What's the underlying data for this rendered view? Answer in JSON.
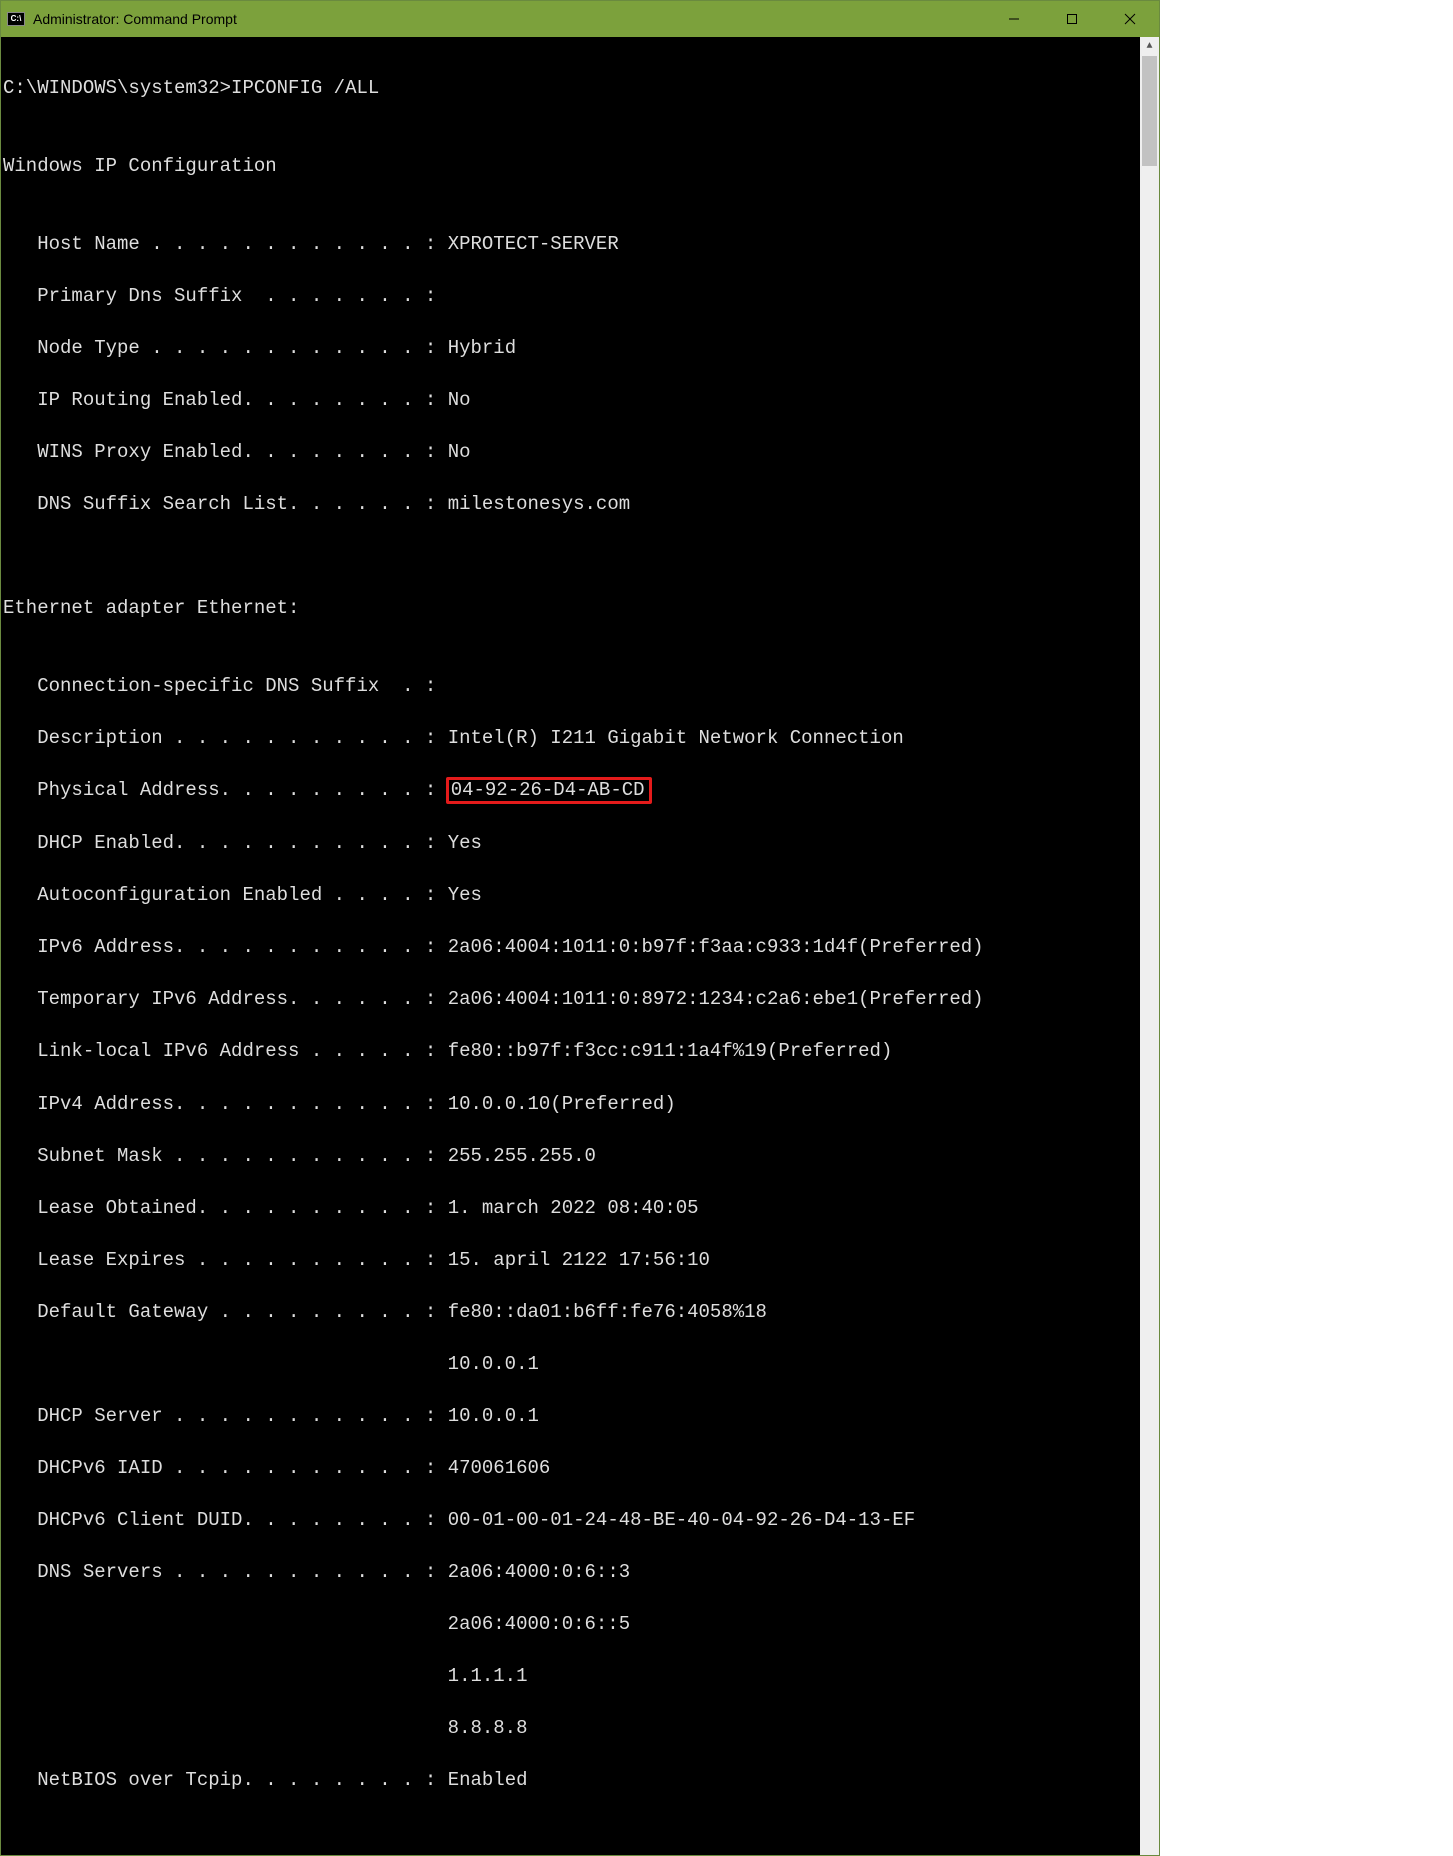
{
  "window": {
    "title": "Administrator: Command Prompt",
    "icon_label": "C:\\"
  },
  "prompt": "C:\\WINDOWS\\system32>",
  "command": "IPCONFIG /ALL",
  "section1_title": "Windows IP Configuration",
  "win_cfg": {
    "host_name_label": "   Host Name . . . . . . . . . . . . : ",
    "host_name": "XPROTECT-SERVER",
    "primary_dns_label": "   Primary Dns Suffix  . . . . . . . :",
    "primary_dns": "",
    "node_type_label": "   Node Type . . . . . . . . . . . . : ",
    "node_type": "Hybrid",
    "ip_routing_label": "   IP Routing Enabled. . . . . . . . : ",
    "ip_routing": "No",
    "wins_proxy_label": "   WINS Proxy Enabled. . . . . . . . : ",
    "wins_proxy": "No",
    "dns_suffix_list_label": "   DNS Suffix Search List. . . . . . : ",
    "dns_suffix_list": "milestonesys.com"
  },
  "section2_title": "Ethernet adapter Ethernet:",
  "eth": {
    "conn_dns_label": "   Connection-specific DNS Suffix  . :",
    "conn_dns": "",
    "description_label": "   Description . . . . . . . . . . . : ",
    "description": "Intel(R) I211 Gigabit Network Connection",
    "physical_addr_label": "   Physical Address. . . . . . . . . : ",
    "physical_addr": "04-92-26-D4-AB-CD",
    "dhcp_enabled_label": "   DHCP Enabled. . . . . . . . . . . : ",
    "dhcp_enabled": "Yes",
    "autoconf_label": "   Autoconfiguration Enabled . . . . : ",
    "autoconf": "Yes",
    "ipv6_addr_label": "   IPv6 Address. . . . . . . . . . . : ",
    "ipv6_addr": "2a06:4004:1011:0:b97f:f3aa:c933:1d4f(Preferred)",
    "temp_ipv6_label": "   Temporary IPv6 Address. . . . . . : ",
    "temp_ipv6": "2a06:4004:1011:0:8972:1234:c2a6:ebe1(Preferred)",
    "link_local_label": "   Link-local IPv6 Address . . . . . : ",
    "link_local": "fe80::b97f:f3cc:c911:1a4f%19(Preferred)",
    "ipv4_addr_label": "   IPv4 Address. . . . . . . . . . . : ",
    "ipv4_addr": "10.0.0.10(Preferred)",
    "subnet_label": "   Subnet Mask . . . . . . . . . . . : ",
    "subnet": "255.255.255.0",
    "lease_obt_label": "   Lease Obtained. . . . . . . . . . : ",
    "lease_obt": "1. march 2022 08:40:05",
    "lease_exp_label": "   Lease Expires . . . . . . . . . . : ",
    "lease_exp": "15. april 2122 17:56:10",
    "gateway_label": "   Default Gateway . . . . . . . . . : ",
    "gateway1": "fe80::da01:b6ff:fe76:4058%18",
    "gateway2": "                                       10.0.0.1",
    "dhcp_server_label": "   DHCP Server . . . . . . . . . . . : ",
    "dhcp_server": "10.0.0.1",
    "dhcpv6_iaid_label": "   DHCPv6 IAID . . . . . . . . . . . : ",
    "dhcpv6_iaid": "470061606",
    "dhcpv6_duid_label": "   DHCPv6 Client DUID. . . . . . . . : ",
    "dhcpv6_duid": "00-01-00-01-24-48-BE-40-04-92-26-D4-13-EF",
    "dns_servers_label": "   DNS Servers . . . . . . . . . . . : ",
    "dns1": "2a06:4000:0:6::3",
    "dns2": "                                       2a06:4000:0:6::5",
    "dns3": "                                       1.1.1.1",
    "dns4": "                                       8.8.8.8",
    "netbios_label": "   NetBIOS over Tcpip. . . . . . . . : ",
    "netbios": "Enabled"
  }
}
